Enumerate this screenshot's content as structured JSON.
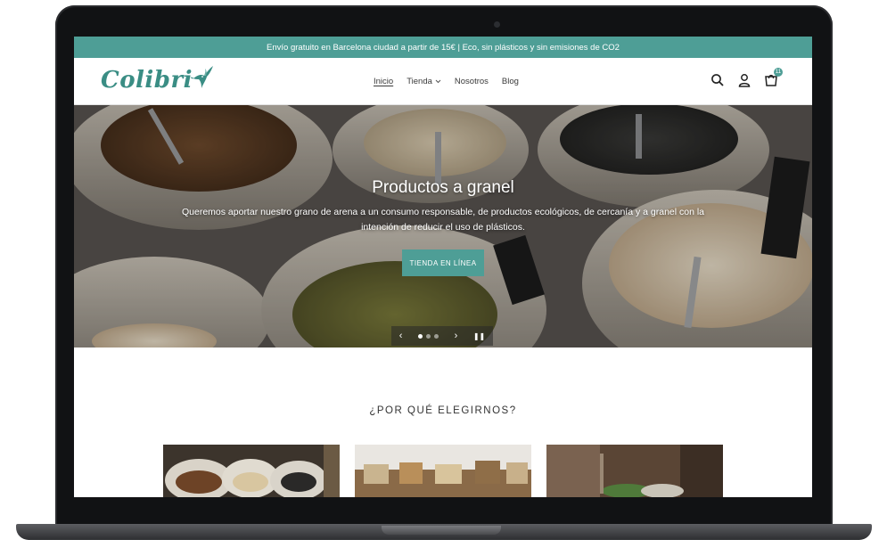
{
  "announcement": "Envío gratuito en Barcelona ciudad a partir de 15€ | Eco, sin plásticos y sin emisiones de CO2",
  "logo": {
    "text": "Colibri"
  },
  "nav": {
    "items": [
      {
        "label": "Inicio",
        "active": true
      },
      {
        "label": "Tienda",
        "has_dropdown": true
      },
      {
        "label": "Nosotros"
      },
      {
        "label": "Blog"
      }
    ]
  },
  "header_icons": {
    "search": "search-icon",
    "account": "user-icon",
    "cart": "cart-icon",
    "cart_count": "11"
  },
  "hero": {
    "title": "Productos a granel",
    "text": "Queremos aportar nuestro grano de arena a un consumo responsable, de productos ecológicos, de cercanía y a granel con la intención de reducir el uso de plásticos.",
    "cta": "TIENDA EN LÍNEA",
    "slides": 3,
    "active_slide": 1
  },
  "why": {
    "title": "¿POR QUÉ ELEGIRNOS?"
  },
  "colors": {
    "accent": "#4e9e96",
    "logo": "#3a8d84"
  }
}
